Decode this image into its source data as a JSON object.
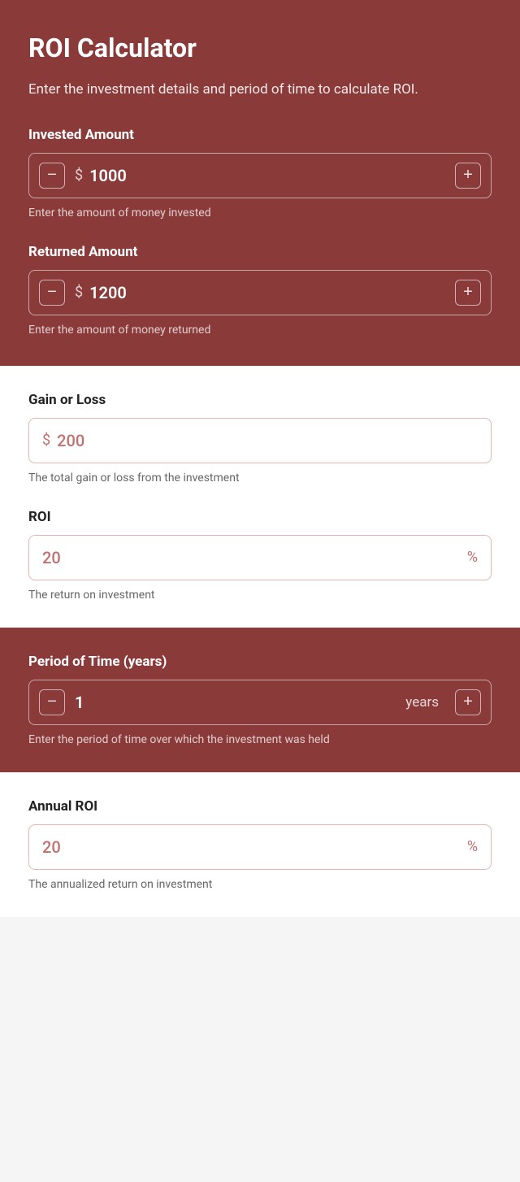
{
  "app": {
    "title": "ROI Calculator",
    "subtitle": "Enter the investment details and period of time to calculate ROI."
  },
  "invested_amount": {
    "label": "Invested Amount",
    "value": "1000",
    "currency": "$",
    "hint": "Enter the amount of money invested"
  },
  "returned_amount": {
    "label": "Returned Amount",
    "value": "1200",
    "currency": "$",
    "hint": "Enter the amount of money returned"
  },
  "gain_or_loss": {
    "label": "Gain or Loss",
    "value": "200",
    "currency": "$",
    "hint": "The total gain or loss from the investment"
  },
  "roi": {
    "label": "ROI",
    "value": "20",
    "suffix": "%",
    "hint": "The return on investment"
  },
  "period_of_time": {
    "label": "Period of Time (years)",
    "value": "1",
    "unit": "years",
    "hint": "Enter the period of time over which the investment was held"
  },
  "annual_roi": {
    "label": "Annual ROI",
    "value": "20",
    "suffix": "%",
    "hint": "The annualized return on investment"
  },
  "buttons": {
    "decrement": "−",
    "increment": "+"
  }
}
